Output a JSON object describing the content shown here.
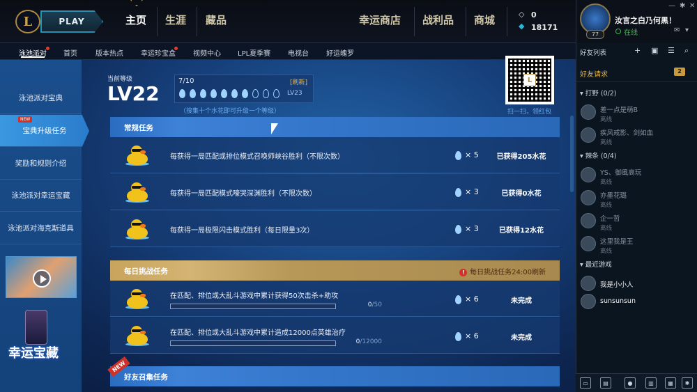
{
  "topbar": {
    "logo": "L",
    "play_label": "PLAY",
    "tabs": [
      {
        "label": "主页",
        "active": true
      },
      {
        "label": "生涯",
        "active": false
      },
      {
        "label": "藏品",
        "active": false
      },
      {
        "label": "幸运商店",
        "active": false
      },
      {
        "label": "战利品",
        "active": false
      },
      {
        "label": "商城",
        "active": false
      }
    ],
    "currency": {
      "essence": "0",
      "rp": "18171"
    }
  },
  "profile": {
    "level": "77",
    "name": "汝言之白乃何黑！",
    "status": "在线"
  },
  "subnav": {
    "items": [
      {
        "label": "泳池派对",
        "dot": true,
        "active": true
      },
      {
        "label": "首页",
        "dot": false,
        "active": false
      },
      {
        "label": "版本热点",
        "dot": false,
        "active": false
      },
      {
        "label": "幸运珍宝盒",
        "dot": true,
        "active": false
      },
      {
        "label": "视频中心",
        "dot": false,
        "active": false
      },
      {
        "label": "LPL夏季赛",
        "dot": false,
        "active": false
      },
      {
        "label": "电视台",
        "dot": false,
        "active": false
      },
      {
        "label": "好运魄罗",
        "dot": false,
        "active": false
      }
    ]
  },
  "leftnav": {
    "items": [
      {
        "label": "泳池派对宝典",
        "active": false
      },
      {
        "label": "宝典升级任务",
        "active": true,
        "tag": "NEW"
      },
      {
        "label": "奖励和规则介绍",
        "active": false
      },
      {
        "label": "泳池派对幸运宝藏",
        "active": false
      },
      {
        "label": "泳池派对海克斯道具",
        "active": false
      }
    ],
    "promo_text": "幸运宝藏"
  },
  "level": {
    "label": "当前等级",
    "current": "LV22",
    "progress_text": "7/10",
    "filled": 7,
    "total": 10,
    "refresh": "[刷新]",
    "next": "LV23",
    "hint": "（搜集十个水花即可升级一个等级）"
  },
  "qr": {
    "caption": "扫一扫，领红包"
  },
  "sections": {
    "regular": {
      "title": "常规任务",
      "rows": [
        {
          "text": "每获得一局匹配或排位模式召唤师峡谷胜利（不限次数）",
          "reward": "× 5",
          "status": "已获得205水花"
        },
        {
          "text": "每获得一局匹配模式嚎哭深渊胜利（不限次数）",
          "reward": "× 3",
          "status": "已获得0水花"
        },
        {
          "text": "每获得一局极限闪击模式胜利（每日限量3次）",
          "reward": "× 3",
          "status": "已获得12水花"
        }
      ]
    },
    "daily": {
      "title": "每日挑战任务",
      "note": "每日挑战任务24:00刷新",
      "rows": [
        {
          "text": "在匹配、排位或大乱斗游戏中累计获得50次击杀+助攻",
          "current": "0",
          "target": "/50",
          "progress": 0,
          "reward": "× 6",
          "status": "未完成"
        },
        {
          "text": "在匹配、排位或大乱斗游戏中累计造成12000点英雄治疗",
          "current": "0",
          "target": "/12000",
          "progress": 0,
          "reward": "× 6",
          "status": "未完成"
        }
      ]
    },
    "friend": {
      "title": "好友召集任务",
      "tag": "NEW"
    }
  },
  "friends": {
    "header": "好友列表",
    "requests_label": "好友请求",
    "requests_count": "2",
    "groups": [
      {
        "label": "打野 (0/2)",
        "items": [
          {
            "name": "差一点是萌B",
            "status": "离线"
          },
          {
            "name": "疾风戒影、剑如血",
            "status": "离线"
          }
        ]
      },
      {
        "label": "辣条 (0/4)",
        "items": [
          {
            "name": "YS、御風高玩",
            "status": "离线"
          },
          {
            "name": "亦墨花璐",
            "status": "离线"
          },
          {
            "name": "企一哲",
            "status": "离线"
          },
          {
            "name": "这里我是王",
            "status": "离线"
          }
        ]
      },
      {
        "label": "最近游戏",
        "items": [
          {
            "name": "我是小小人",
            "status": ""
          },
          {
            "name": "sunsunsun",
            "status": ""
          }
        ]
      }
    ]
  },
  "colors": {
    "accent": "#3e82d8",
    "gold": "#c8a45c",
    "online": "#38b84c"
  }
}
